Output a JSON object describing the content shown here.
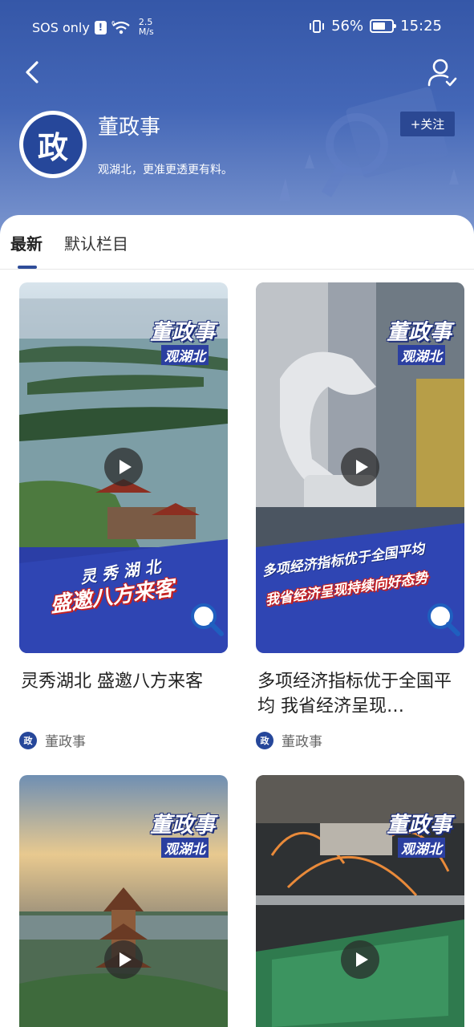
{
  "status_bar": {
    "carrier": "SOS only",
    "net_speed_value": "2.5",
    "net_speed_unit": "M/s",
    "battery": "56%",
    "time": "15:25",
    "signal_label": "6"
  },
  "header": {
    "channel_name": "董政事",
    "channel_description": "观湖北，更准更透更有料。",
    "follow_label": "+关注",
    "logo_glyph": "政"
  },
  "tabs": [
    {
      "label": "最新",
      "active": true
    },
    {
      "label": "默认栏目",
      "active": false
    }
  ],
  "brand": {
    "badge_title": "董政事",
    "badge_subtitle": "观湖北"
  },
  "cards": [
    {
      "title": "灵秀湖北  盛邀八方来客",
      "source": "董政事",
      "overlay_line1": "灵 秀 湖 北",
      "overlay_line2": "盛邀八方来客"
    },
    {
      "title": "多项经济指标优于全国平均  我省经济呈现…",
      "source": "董政事",
      "overlay_line1": "多项经济指标优于全国平均",
      "overlay_line2": "我省经济呈现持续向好态势"
    },
    {
      "title": "",
      "source": ""
    },
    {
      "title": "",
      "source": ""
    }
  ],
  "colors": {
    "header_top": "#3557a8",
    "accent_blue": "#2f4d99",
    "follow_bg": "#2b4893"
  }
}
